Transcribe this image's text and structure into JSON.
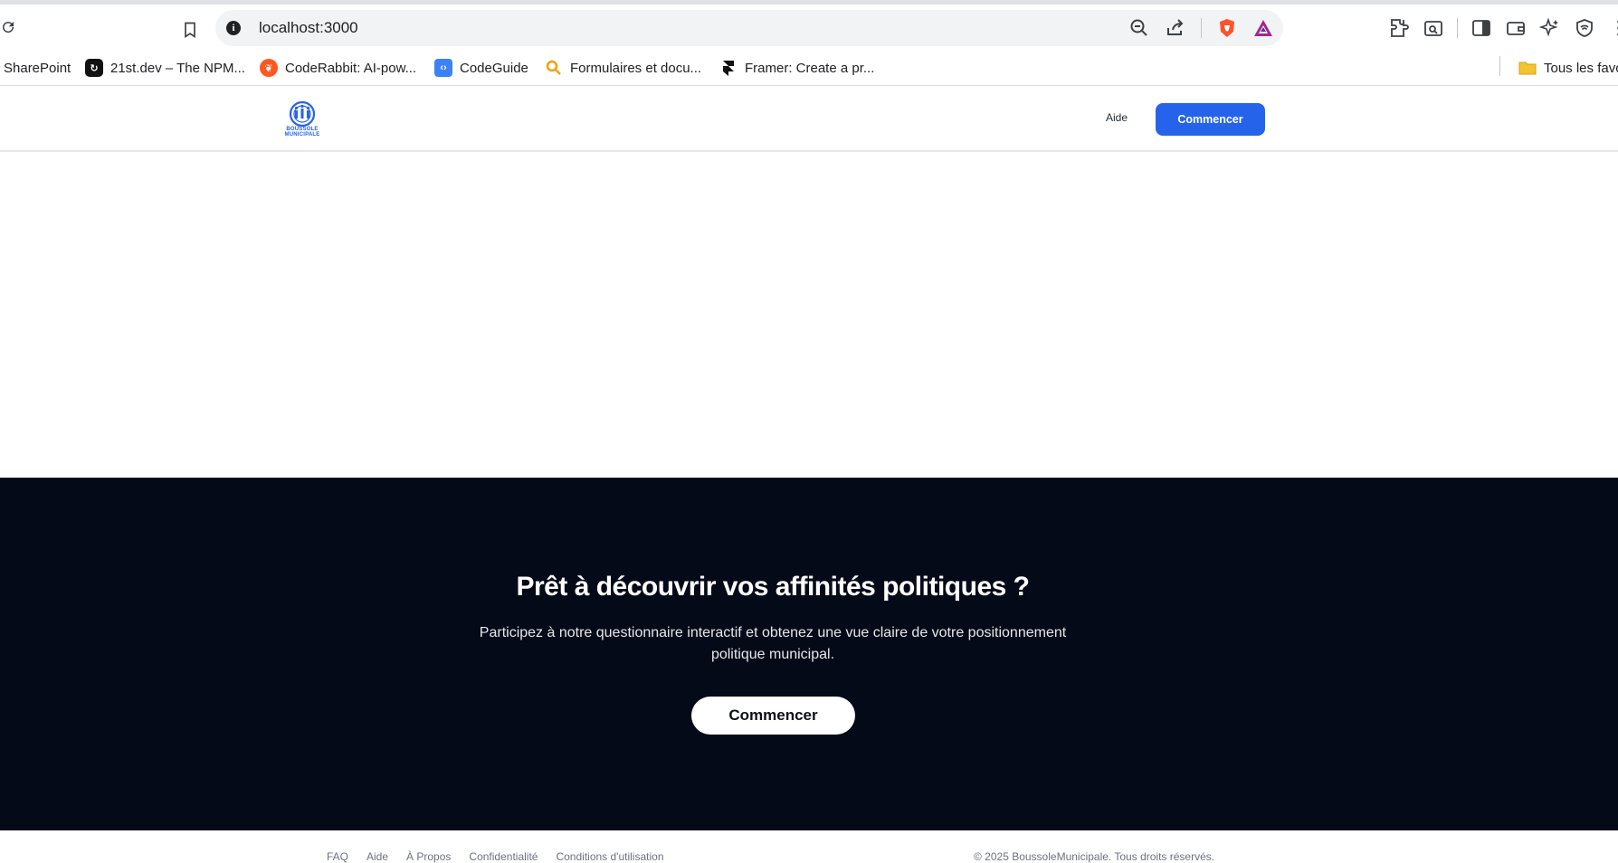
{
  "browser": {
    "url": "localhost:3000",
    "bookmarks": [
      {
        "label": "SharePoint",
        "icon": "sharepoint-icon"
      },
      {
        "label": "21st.dev – The NPM...",
        "icon": "21st-dev-icon"
      },
      {
        "label": "CodeRabbit: AI-pow...",
        "icon": "coderabbit-icon"
      },
      {
        "label": "CodeGuide",
        "icon": "codeguide-icon"
      },
      {
        "label": "Formulaires et docu...",
        "icon": "search-favicon"
      },
      {
        "label": "Framer: Create a pr...",
        "icon": "framer-icon"
      },
      {
        "label": "Tous les favo",
        "icon": "folder-icon"
      }
    ]
  },
  "header": {
    "logo_text": "BOUSSOLE MUNICIPALE",
    "nav_help": "Aide",
    "start_button": "Commencer"
  },
  "cta": {
    "title": "Prêt à découvrir vos affinités politiques ?",
    "text": "Participez à notre questionnaire interactif et obtenez une vue claire de votre positionnement politique municipal.",
    "button": "Commencer"
  },
  "footer": {
    "links": [
      "FAQ",
      "Aide",
      "À Propos",
      "Confidentialité",
      "Conditions d'utilisation"
    ],
    "copyright": "© 2025 BoussoleMunicipale. Tous droits réservés."
  },
  "colors": {
    "accent": "#2563eb",
    "cta_background": "#050a18"
  }
}
